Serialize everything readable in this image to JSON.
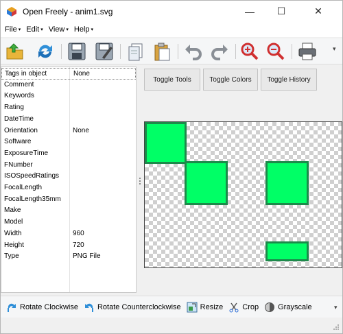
{
  "window": {
    "title": "Open Freely - anim1.svg",
    "controls": {
      "minimize": "—",
      "maximize": "☐",
      "close": "✕"
    }
  },
  "menu": [
    {
      "label": "File",
      "caret": "▾"
    },
    {
      "label": "Edit",
      "caret": "▾"
    },
    {
      "label": "View",
      "caret": "▾"
    },
    {
      "label": "Help",
      "caret": "▾"
    }
  ],
  "toolbar": {
    "buttons": [
      "open-folder-icon",
      "refresh-icon",
      "save-icon",
      "save-as-icon",
      "copy-icon",
      "paste-icon",
      "undo-icon",
      "redo-icon",
      "zoom-in-icon",
      "zoom-out-icon",
      "print-icon"
    ],
    "overflow": "▾"
  },
  "properties": [
    {
      "key": "Tags in object",
      "value": "None"
    },
    {
      "key": "Comment",
      "value": ""
    },
    {
      "key": "Keywords",
      "value": ""
    },
    {
      "key": "Rating",
      "value": ""
    },
    {
      "key": "DateTime",
      "value": ""
    },
    {
      "key": "Orientation",
      "value": "None"
    },
    {
      "key": "Software",
      "value": ""
    },
    {
      "key": "ExposureTime",
      "value": ""
    },
    {
      "key": "FNumber",
      "value": ""
    },
    {
      "key": "ISOSpeedRatings",
      "value": ""
    },
    {
      "key": "FocalLength",
      "value": ""
    },
    {
      "key": "FocalLength35mm",
      "value": ""
    },
    {
      "key": "Make",
      "value": ""
    },
    {
      "key": "Model",
      "value": ""
    },
    {
      "key": "Width",
      "value": "960"
    },
    {
      "key": "Height",
      "value": "720"
    },
    {
      "key": "Type",
      "value": "PNG File"
    }
  ],
  "toggles": {
    "tools": "Toggle Tools",
    "colors": "Toggle Colors",
    "history": "Toggle History"
  },
  "image": {
    "fill_color": "#00ff66",
    "stroke_color": "#1c8a4a",
    "checker_color": "#cfcfcf"
  },
  "bottom_tools": [
    {
      "label": "Rotate Clockwise",
      "icon": "rotate-clockwise-icon"
    },
    {
      "label": "Rotate Counterclockwise",
      "icon": "rotate-counterclockwise-icon"
    },
    {
      "label": "Resize",
      "icon": "resize-icon"
    },
    {
      "label": "Crop",
      "icon": "crop-icon"
    },
    {
      "label": "Grayscale",
      "icon": "grayscale-icon"
    }
  ],
  "bottom_overflow": "▾"
}
